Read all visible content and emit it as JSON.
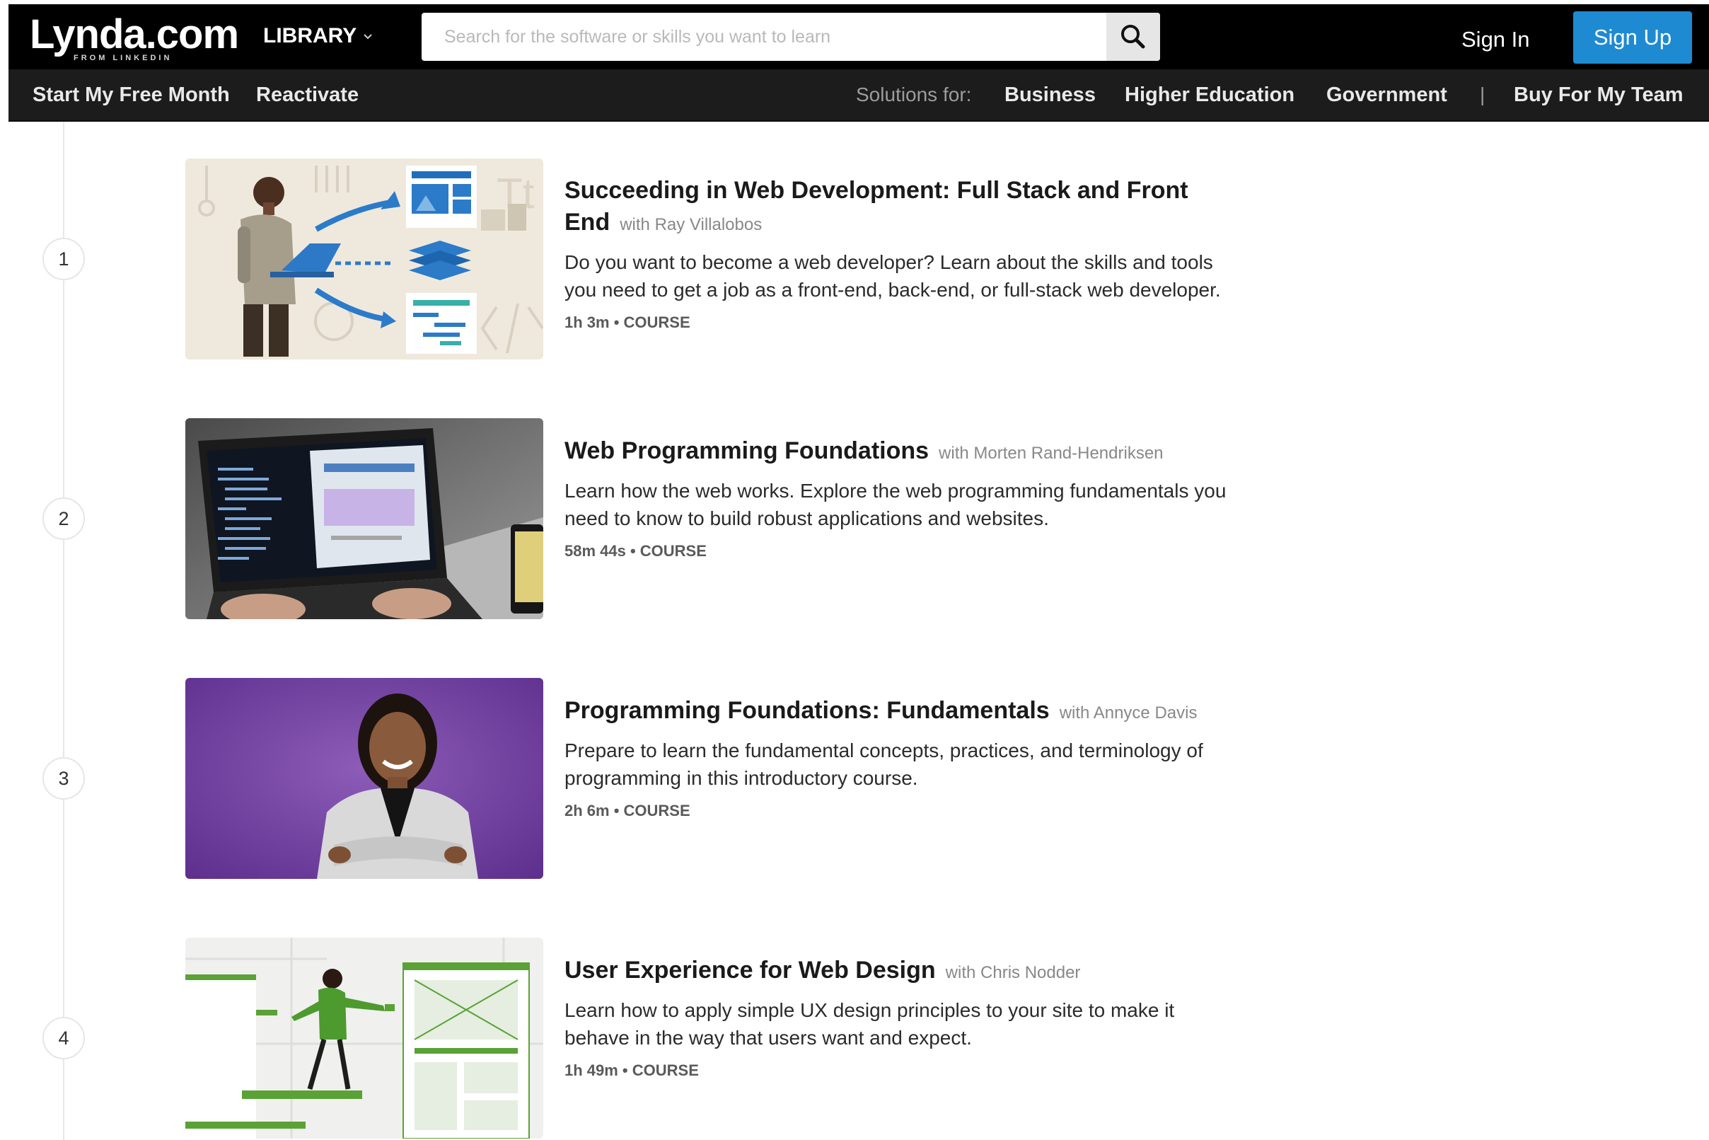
{
  "header": {
    "logo_text": "Lynda.com",
    "logo_subtext": "FROM LINKEDIN",
    "library_label": "LIBRARY",
    "search": {
      "placeholder": "Search for the software or skills you want to learn",
      "value": ""
    },
    "sign_in_label": "Sign In",
    "sign_up_label": "Sign Up",
    "accent_color": "#1e8ad2"
  },
  "subnav": {
    "left_links": [
      "Start My Free Month",
      "Reactivate"
    ],
    "solutions_label": "Solutions for:",
    "solution_links": [
      "Business",
      "Higher Education",
      "Government"
    ],
    "separator": "|",
    "team_link": "Buy For My Team"
  },
  "courses": [
    {
      "number": "1",
      "title": "Succeeding in Web Development: Full Stack and Front End",
      "author": "with Ray Villalobos",
      "description": "Do you want to become a web developer? Learn about the skills and tools you need to get a job as a front-end, back-end, or full-stack web developer.",
      "meta": "1h 3m • COURSE"
    },
    {
      "number": "2",
      "title": "Web Programming Foundations",
      "author": "with Morten Rand-Hendriksen",
      "description": "Learn how the web works. Explore the web programming fundamentals you need to know to build robust applications and websites.",
      "meta": "58m 44s • COURSE"
    },
    {
      "number": "3",
      "title": "Programming Foundations: Fundamentals",
      "author": "with Annyce Davis",
      "description": "Prepare to learn the fundamental concepts, practices, and terminology of programming in this introductory course.",
      "meta": "2h 6m • COURSE"
    },
    {
      "number": "4",
      "title": "User Experience for Web Design",
      "author": "with Chris Nodder",
      "description": "Learn how to apply simple UX design principles to your site to make it behave in the way that users want and expect.",
      "meta": "1h 49m • COURSE"
    }
  ]
}
